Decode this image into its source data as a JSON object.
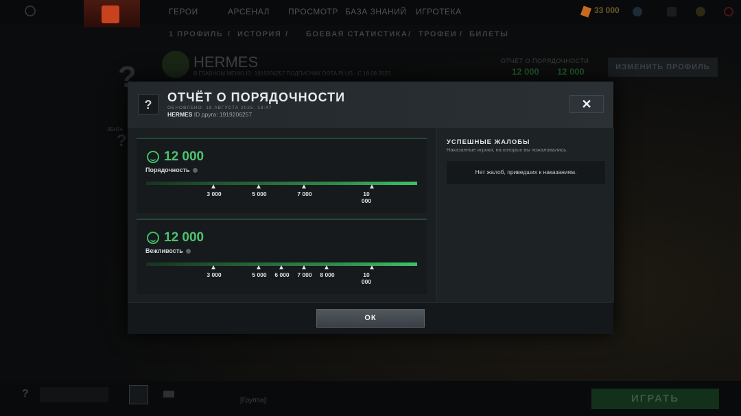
{
  "top_nav": {
    "items": [
      "ГЕРОИ",
      "АРСЕНАЛ",
      "ПРОСМОТР",
      "БАЗА ЗНАНИЙ",
      "ИГРОТЕКА"
    ],
    "shards": "33 000"
  },
  "profile_tabs": {
    "items": [
      "1 ПРОФИЛЬ",
      "/",
      "ИСТОРИЯ",
      "/",
      "БОЕВАЯ СТАТИСТИКА",
      "/",
      "ТРОФЕИ",
      "/",
      "БИЛЕТЫ"
    ]
  },
  "profile": {
    "name": "HERMES",
    "sub": "В ГЛАВНОМ МЕНЮ   ID: 1919206257   ПОДПИСЧИК DOTA PLUS · С 18.08.2025",
    "conduct_label": "ОТЧЁТ О ПОРЯДОЧНОСТИ",
    "conduct_score_1": "12 000",
    "conduct_score_2": "12 000",
    "edit_button": "ИЗМЕНИТЬ ПРОФИЛЬ",
    "feed_label": "ЛЕНТА"
  },
  "bottom": {
    "play_button": "ИГРАТЬ",
    "chat_text": "[Группа]:"
  },
  "modal": {
    "icon": "?",
    "title": "ОТЧЁТ О ПОРЯДОЧНОСТИ",
    "updated": "ОБНОВЛЕНО: 18 АВГУСТА 2025, 18:47",
    "user_name": "HERMES",
    "user_id": "ID друга: 1919206257",
    "close_icon": "✕",
    "conduct": {
      "score": "12 000",
      "label": "Порядочность",
      "level": 1.0,
      "ticks": [
        "3 000",
        "5 000",
        "7 000",
        "10 000"
      ]
    },
    "behavior": {
      "score": "12 000",
      "label": "Вежливость",
      "level": 1.0,
      "ticks": [
        "3 000",
        "5 000",
        "6 000",
        "7 000",
        "8 000",
        "10 000"
      ]
    },
    "reports": {
      "title": "УСПЕШНЫЕ ЖАЛОБЫ",
      "subtitle": "Наказанные игроки, на которых вы пожаловались.",
      "empty": "Нет жалоб, приведших к наказаниям."
    },
    "ok_button": "ОК"
  }
}
